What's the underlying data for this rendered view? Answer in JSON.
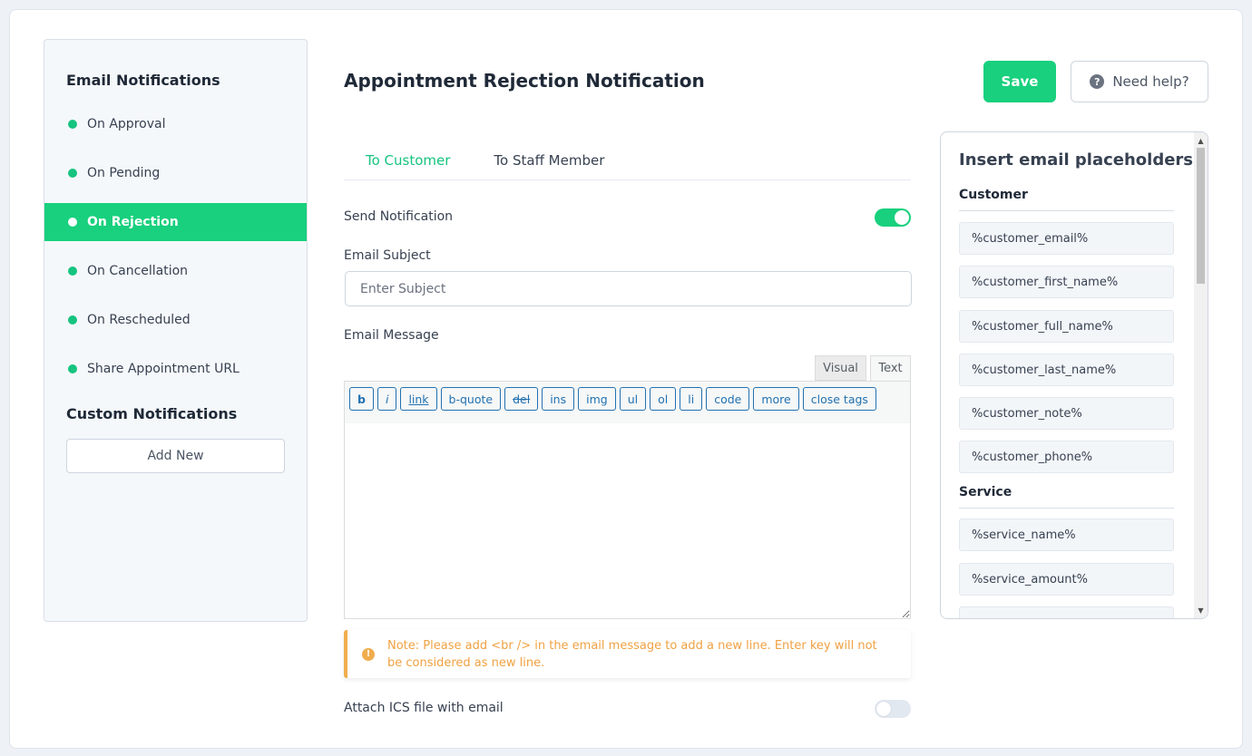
{
  "sidebar": {
    "heading": "Email Notifications",
    "items": [
      {
        "label": "On Approval",
        "active": false
      },
      {
        "label": "On Pending",
        "active": false
      },
      {
        "label": "On Rejection",
        "active": true
      },
      {
        "label": "On Cancellation",
        "active": false
      },
      {
        "label": "On Rescheduled",
        "active": false
      },
      {
        "label": "Share Appointment URL",
        "active": false
      }
    ],
    "custom_heading": "Custom Notifications",
    "add_new_label": "Add New"
  },
  "header": {
    "title": "Appointment Rejection Notification",
    "save_label": "Save",
    "help_label": "Need help?",
    "help_icon_glyph": "?"
  },
  "tabs": [
    {
      "label": "To Customer",
      "active": true
    },
    {
      "label": "To Staff Member",
      "active": false
    }
  ],
  "form": {
    "send_notification_label": "Send Notification",
    "send_notification_on": true,
    "subject_label": "Email Subject",
    "subject_value": "",
    "subject_placeholder": "Enter Subject",
    "message_label": "Email Message",
    "editor_tabs": {
      "visual": "Visual",
      "text": "Text",
      "active": "text"
    },
    "toolbar": {
      "b": "b",
      "i": "i",
      "link": "link",
      "bquote": "b-quote",
      "del": "del",
      "ins": "ins",
      "img": "img",
      "ul": "ul",
      "ol": "ol",
      "li": "li",
      "code": "code",
      "more": "more",
      "close": "close tags"
    },
    "message_value": "",
    "note_icon_glyph": "!",
    "note": "Note: Please add <br /> in the email message to add a new line. Enter key will not be considered as new line.",
    "ics_label": "Attach ICS file with email",
    "ics_on": false
  },
  "placeholders": {
    "title": "Insert email placeholders",
    "groups": [
      {
        "name": "Customer",
        "items": [
          "%customer_email%",
          "%customer_first_name%",
          "%customer_full_name%",
          "%customer_last_name%",
          "%customer_note%",
          "%customer_phone%"
        ]
      },
      {
        "name": "Service",
        "items": [
          "%service_name%",
          "%service_amount%"
        ]
      }
    ]
  },
  "colors": {
    "accent": "#18d07d",
    "note": "#f0ad4e",
    "link": "#2271b1"
  }
}
